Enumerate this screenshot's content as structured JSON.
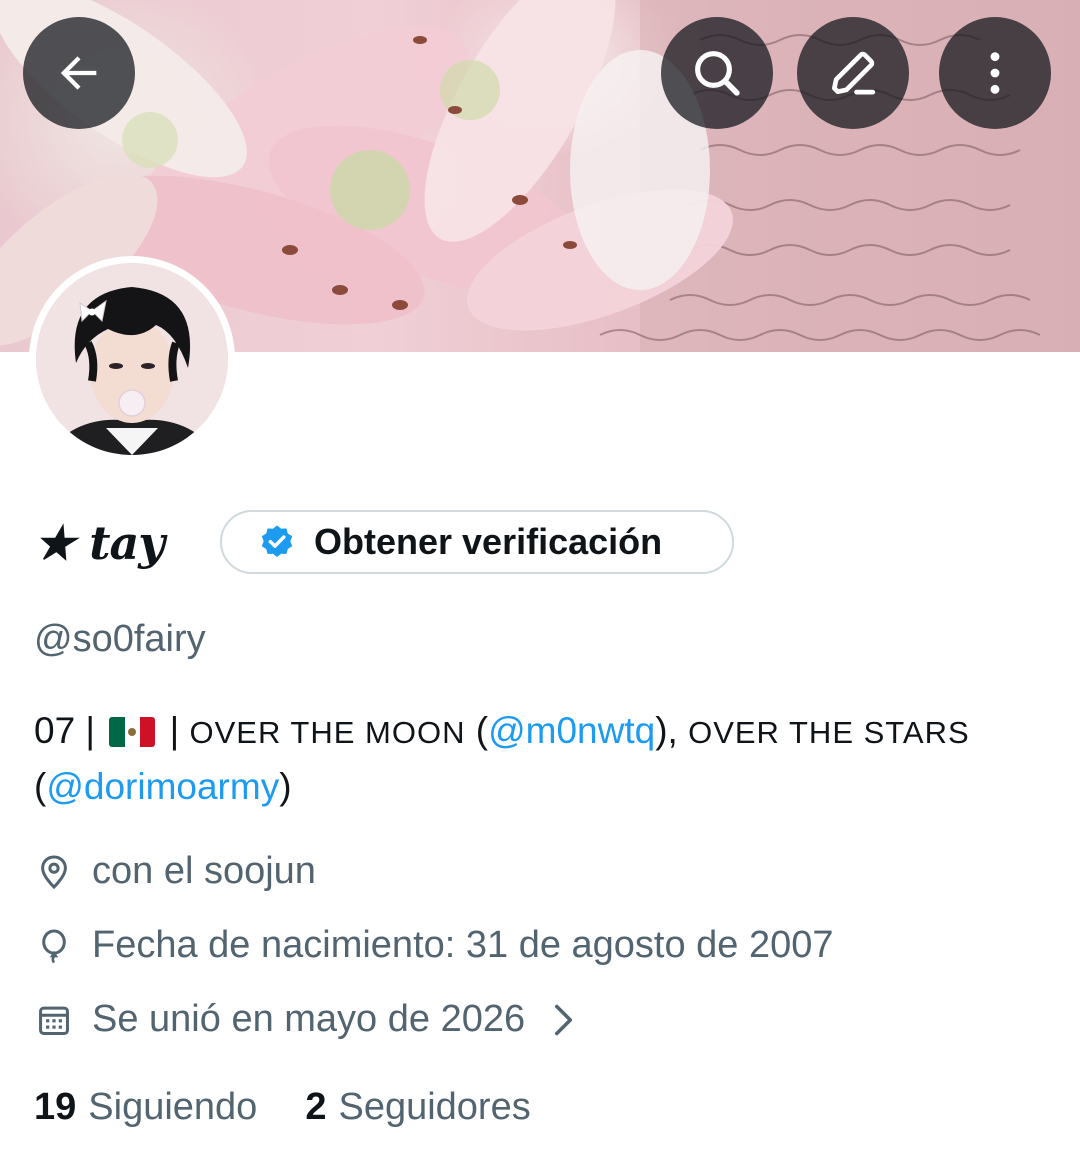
{
  "header": {
    "back_icon": "arrow-left-icon",
    "search_icon": "search-icon",
    "edit_icon": "pencil-icon",
    "more_icon": "more-vertical-icon"
  },
  "profile": {
    "display_name": "★ tay",
    "verify_button": "Obtener verificación",
    "handle": "@so0fairy",
    "bio": {
      "prefix": "07 | ",
      "flag": "flag-mexico-icon",
      "sep": " | ",
      "text1": "OVER THE MOON",
      "open1": " (",
      "mention1": "@m0nwtq",
      "close1": "), ",
      "text2": "OVER THE STARS",
      "open2": "(",
      "mention2": "@dorimoarmy",
      "close2": ")"
    },
    "location": "con el soojun",
    "birthday": "Fecha de nacimiento: 31 de agosto de 2007",
    "joined": "Se unió en mayo de 2026"
  },
  "stats": {
    "following_count": "19",
    "following_label": "Siguiendo",
    "followers_count": "2",
    "followers_label": "Seguidores"
  },
  "colors": {
    "accent": "#1d9bf0",
    "text": "#0f1419",
    "secondary": "#536471",
    "border": "#cfd9de"
  }
}
